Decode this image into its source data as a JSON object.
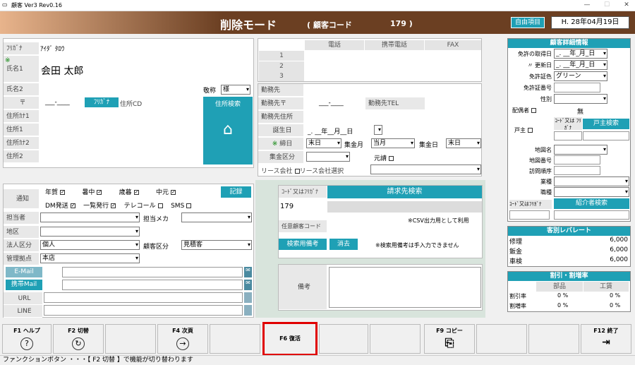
{
  "window": {
    "title": "顧客 Ver3 Rev0.16"
  },
  "header": {
    "mode": "削除モード",
    "code_label": "( 顧客コード",
    "code_value": "179 )",
    "jiyu": "自由項目",
    "date": "H. 28年04月19日"
  },
  "left": {
    "furigana_label": "ﾌﾘｶﾞﾅ",
    "furigana": "ｱｲﾀﾞ ﾀﾛｳ",
    "asterisk": "※",
    "name1_label": "氏名1",
    "name1": "会田 太郎",
    "name2_label": "氏名2",
    "keisho_label": "敬称",
    "keisho": "様",
    "zip_label": "〒",
    "zip": "___-____",
    "furigana_btn": "ﾌﾘｶﾞﾅ",
    "jushocd": "住所CD",
    "jusho_search": "住所検索",
    "addr_kana1": "住所ｶﾅ1",
    "addr1": "住所1",
    "addr_kana2": "住所ｶﾅ2",
    "addr2": "住所2"
  },
  "phone": {
    "headers": [
      "電話",
      "携帯電話",
      "FAX"
    ],
    "rows": [
      "1",
      "2",
      "3"
    ]
  },
  "work": {
    "kinmu": "勤務先",
    "kinmu_zip": "勤務先〒",
    "zip_val": "___-____",
    "kinmu_tel": "勤務先TEL",
    "kinmu_addr": "勤務先住所",
    "birth": "誕生日",
    "birth_val": "_. __年__月__日",
    "shime_mark": "※",
    "shime": "締日",
    "shime_val": "末日",
    "shukin_tsuki": "集金月",
    "shukin_tsuki_val": "当月",
    "shukin_bi": "集金日",
    "shukin_bi_val": "末日",
    "shukin_kubun": "集金区分",
    "motouke": "元請",
    "lease": "リース会社",
    "lease_sel": "リース会社選択"
  },
  "notify": {
    "label": "通知",
    "items": [
      "年賀",
      "暑中",
      "歳暮",
      "中元"
    ],
    "kiroku": "記録",
    "dm": "DM発送",
    "ichiran": "一覧発行",
    "telecall": "テレコール",
    "sms": "SMS"
  },
  "misc": {
    "tanto": "担当者",
    "tanto_maker": "担当メカ",
    "chiku": "地区",
    "hojin": "法人区分",
    "hojin_val": "個人",
    "kokyaku_kubun": "顧客区分",
    "kokyaku_kubun_val": "見積客",
    "kanri": "管理拠点",
    "kanri_val": "本店",
    "email": "E-Mail",
    "keitai_mail": "携帯Mail",
    "url": "URL",
    "line": "LINE"
  },
  "billing": {
    "code_label": "ｺｰﾄﾞ又はﾌﾘｶﾞﾅ",
    "search": "請求先検索",
    "code_val": "179",
    "csv_note": "※CSV出力用として利用",
    "nini": "任意顧客コード",
    "kensaku_biko": "検索用備考",
    "kesu": "消去",
    "note2": "※検索用備考は手入力できません",
    "biko": "備考"
  },
  "detail": {
    "title": "顧客詳細情報",
    "menkyo_date": "免許の取得日",
    "menkyo_date_val": "_. __年_月_日",
    "koshin": "〃 更新日",
    "koshin_val": "_. __年_月_日",
    "iro": "免許証色",
    "iro_val": "グリーン",
    "bango": "免許証番号",
    "seibetsu": "性別",
    "haigusha": "配偶者",
    "haigusha_val": "無",
    "koshu": "戸主",
    "code_furi": "ｺｰﾄﾞ又は ﾌﾘｶﾞﾅ",
    "koshu_search": "戸主検索",
    "chizu": "地図名",
    "chizu_no": "地図番号",
    "homon": "訪問順序",
    "gyoshu": "業種",
    "shokushu": "職種",
    "code_furi2": "ｺｰﾄﾞ又はﾌﾘｶﾞﾅ",
    "shokai": "紹介者検索"
  },
  "rate": {
    "title": "客別レバレート",
    "rows": [
      {
        "label": "修理",
        "value": "6,000"
      },
      {
        "label": "鈑金",
        "value": "6,000"
      },
      {
        "label": "車検",
        "value": "6,000"
      }
    ]
  },
  "discount": {
    "title": "割引・割増率",
    "cols": [
      "部品",
      "工賃"
    ],
    "rows": [
      {
        "label": "割引率",
        "a": "0 %",
        "b": "0 %"
      },
      {
        "label": "割増率",
        "a": "0 %",
        "b": "0 %"
      }
    ]
  },
  "fkeys": {
    "f1": "F1 ヘルプ",
    "f2": "F2 切替",
    "f4": "F4 次頁",
    "f6": "F6 復活",
    "f9": "F9 コピー",
    "f12": "F12 終了"
  },
  "status": "ファンクションボタン ・・・【 F2 切替 】で機能が切り替わります",
  "colors": {
    "accent": "#1fa0b5",
    "header": "#6b3f22",
    "highlight": "#e00000"
  }
}
